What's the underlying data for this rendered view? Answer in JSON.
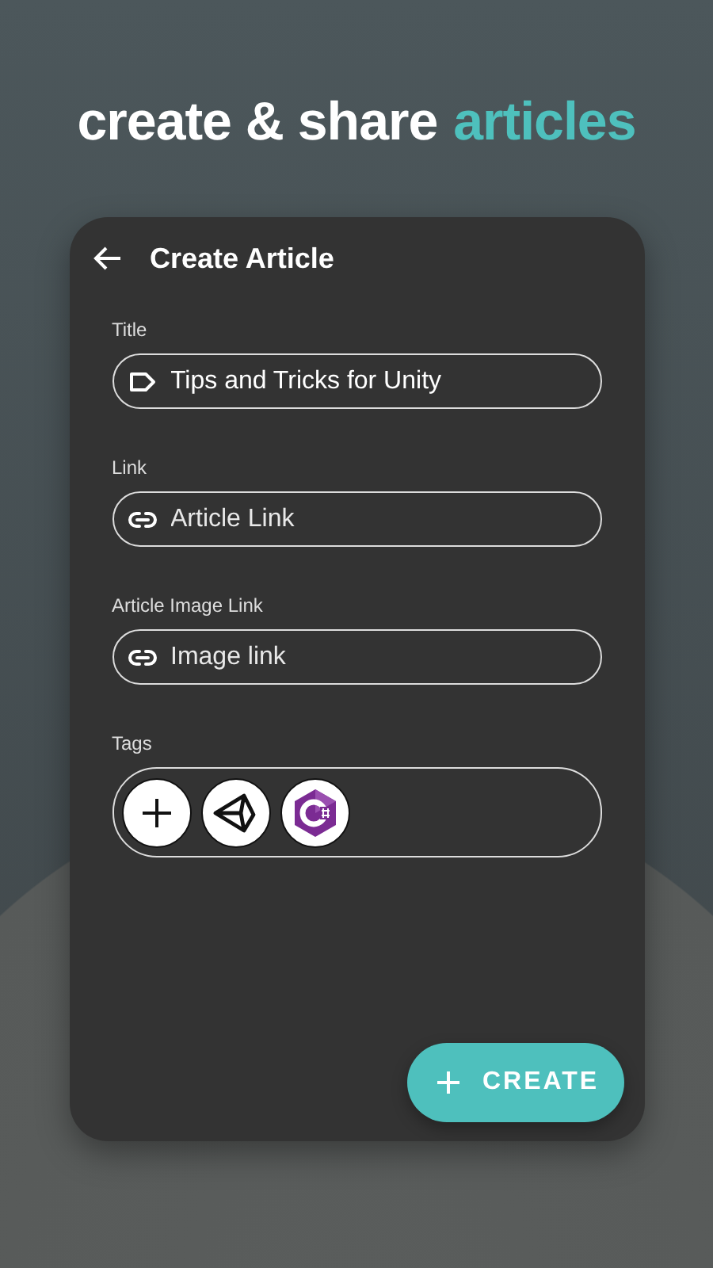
{
  "headline": {
    "lead": "create & share",
    "accent": "articles"
  },
  "screen": {
    "title": "Create Article"
  },
  "fields": [
    {
      "label": "Title",
      "kind": "tag",
      "value": "Tips and Tricks for Unity"
    },
    {
      "label": "Link",
      "kind": "link",
      "placeholder": "Article Link"
    },
    {
      "label": "Article Image Link",
      "kind": "link",
      "placeholder": "Image link"
    }
  ],
  "tags": {
    "label": "Tags",
    "items": [
      {
        "kind": "add"
      },
      {
        "kind": "unity"
      },
      {
        "kind": "csharp"
      }
    ]
  },
  "create_button": {
    "label": "CREATE"
  }
}
